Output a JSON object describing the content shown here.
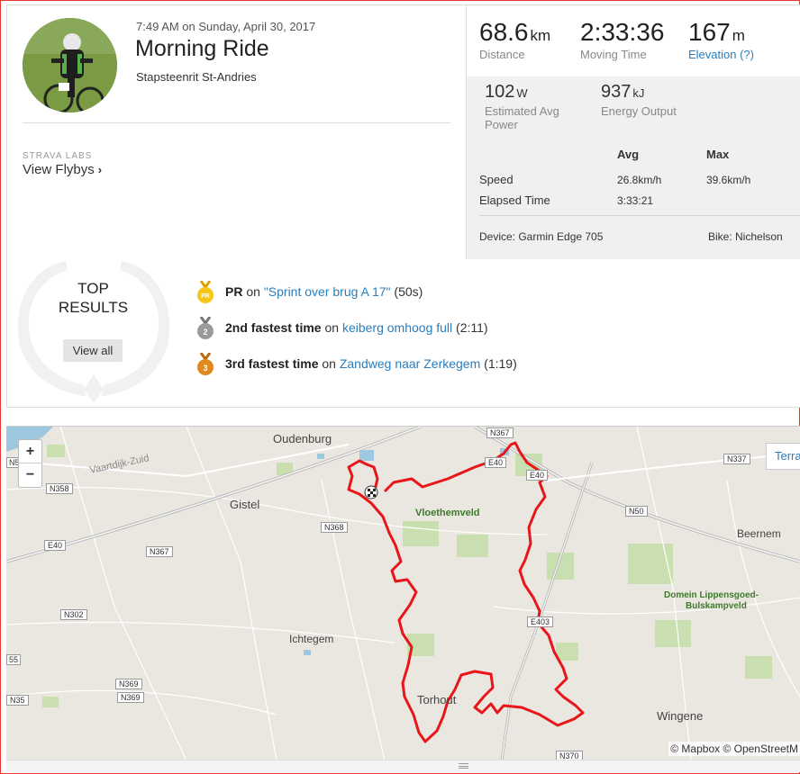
{
  "activity": {
    "datetime": "7:49 AM on Sunday, April 30, 2017",
    "title": "Morning Ride",
    "location": "Stapsteenrit St-Andries"
  },
  "labs": {
    "label": "STRAVA LABS",
    "link": "View Flybys"
  },
  "stats": {
    "distance": {
      "value": "68.6",
      "unit": "km",
      "label": "Distance"
    },
    "moving_time": {
      "value": "2:33:36",
      "label": "Moving Time"
    },
    "elevation": {
      "value": "167",
      "unit": "m",
      "label": "Elevation (?)"
    },
    "power": {
      "value": "102",
      "unit": "W",
      "label": "Estimated Avg Power"
    },
    "energy": {
      "value": "937",
      "unit": "kJ",
      "label": "Energy Output"
    },
    "table": {
      "headers": [
        "Avg",
        "Max"
      ],
      "rows": [
        {
          "label": "Speed",
          "avg": "26.8km/h",
          "max": "39.6km/h"
        },
        {
          "label": "Elapsed Time",
          "avg": "3:33:21",
          "max": ""
        }
      ]
    },
    "device": "Device: Garmin Edge 705",
    "bike": "Bike: Nichelson"
  },
  "results": {
    "title": "TOP RESULTS",
    "view_all": "View all",
    "items": [
      {
        "medal": "PR",
        "color": "#f5c518",
        "strong": "PR",
        "on": "on",
        "segment": "\"Sprint over brug A 17\"",
        "time": "(50s)"
      },
      {
        "medal": "2",
        "color": "#9a9a9a",
        "strong": "2nd fastest time",
        "on": "on",
        "segment": "keiberg omhoog full",
        "time": "(2:11)"
      },
      {
        "medal": "3",
        "color": "#e08a1e",
        "strong": "3rd fastest time",
        "on": "on",
        "segment": "Zandweg naar Zerkegem",
        "time": "(1:19)"
      }
    ]
  },
  "map": {
    "zoom_in": "+",
    "zoom_out": "−",
    "layer_button": "Terra",
    "attribution": "© Mapbox © OpenStreetM",
    "places": {
      "oudenburg": "Oudenburg",
      "gistel": "Gistel",
      "vloethemveld": "Vloethemveld",
      "beernem": "Beernem",
      "domein1": "Domein Lippensgoed-",
      "domein2": "Bulskampveld",
      "ichtegem": "Ichtegem",
      "torhout": "Torhout",
      "wingene": "Wingene",
      "vaartdijk": "Vaartdijk-Zuid"
    },
    "roads": {
      "n367_top": "N367",
      "e40_a": "E40",
      "e40_b": "E40",
      "e40_left": "E40",
      "n337": "N337",
      "n358": "N358",
      "n368": "N368",
      "n367_left": "N367",
      "n50": "N50",
      "n302": "N302",
      "e403": "E403",
      "n369_a": "N369",
      "n369_b": "N369",
      "n35": "N35",
      "n370": "N370",
      "n5": "N5",
      "n55": "55"
    },
    "route_color": "#e8161b"
  }
}
